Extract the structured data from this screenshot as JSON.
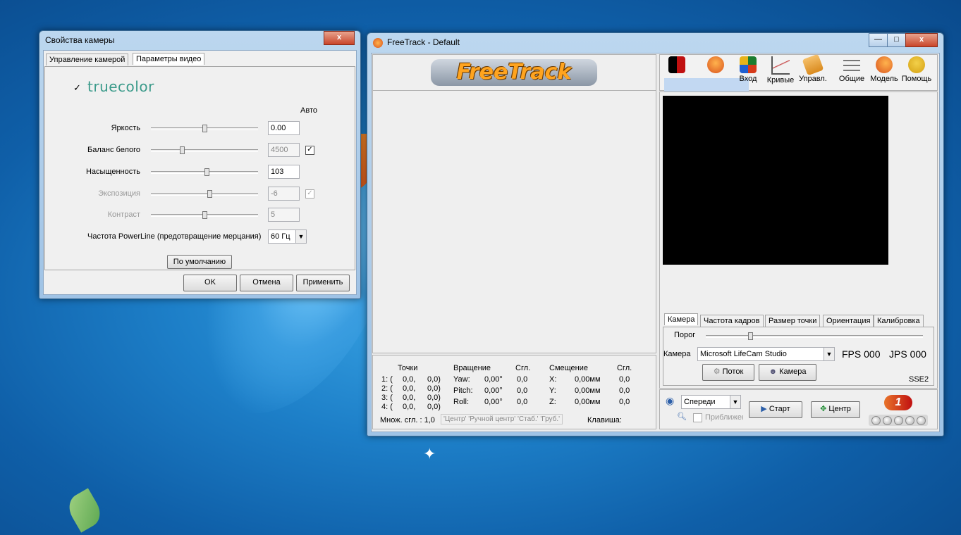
{
  "camera_dialog": {
    "title": "Свойства камеры",
    "close_glyph": "x",
    "tabs": [
      "Управление камерой",
      "Параметры видео"
    ],
    "logo_text": "truecolor",
    "logo_checked": "✓",
    "auto_header": "Авто",
    "rows": [
      {
        "label": "Яркость",
        "value": "0.00",
        "level": 0.5,
        "auto": null
      },
      {
        "label": "Баланс белого",
        "value": "4500",
        "level": 0.28,
        "auto": "✓"
      },
      {
        "label": "Насыщенность",
        "value": "103",
        "level": 0.52,
        "auto": null
      },
      {
        "label": "Экспозиция",
        "value": "-6",
        "level": 0.55,
        "auto": "✓"
      },
      {
        "label": "Контраст",
        "value": "5",
        "level": 0.5,
        "auto": null
      }
    ],
    "powerline_label": "Частота PowerLine (предотвращение мерцания)",
    "powerline_value": "60 Гц",
    "default_button": "По умолчанию",
    "ok_button": "OK",
    "cancel_button": "Отмена",
    "apply_button": "Применить"
  },
  "freetrack": {
    "title": "FreeTrack - Default",
    "logo_text": "FreeTrack",
    "min_glyph": "—",
    "max_glyph": "□",
    "close_glyph": "x",
    "toolbar": [
      {
        "label": "",
        "icon": "camera-icon"
      },
      {
        "label": "",
        "icon": "head-icon"
      },
      {
        "label": "Вход",
        "icon": "arrows-icon"
      },
      {
        "label": "Кривые",
        "icon": "curve-icon"
      },
      {
        "label": "Управл.",
        "icon": "keyboard-icon"
      },
      {
        "label": "Общие",
        "icon": "sliders-icon"
      },
      {
        "label": "Модель",
        "icon": "model-icon"
      },
      {
        "label": "Помощь",
        "icon": "help-icon"
      }
    ],
    "stats": {
      "points_header": "Точки",
      "rotation_header": "Вращение",
      "smooth_header1": "Сгл.",
      "offset_header": "Смещение",
      "smooth_header2": "Сгл.",
      "points": [
        {
          "id": "1: (",
          "x": "0,0,",
          "y": "0,0)"
        },
        {
          "id": "2: (",
          "x": "0,0,",
          "y": "0,0)"
        },
        {
          "id": "3: (",
          "x": "0,0,",
          "y": "0,0)"
        },
        {
          "id": "4: (",
          "x": "0,0,",
          "y": "0,0)"
        }
      ],
      "rotation": [
        {
          "axis": "Yaw:",
          "value": "0,00°",
          "smooth": "0,0"
        },
        {
          "axis": "Pitch:",
          "value": "0,00°",
          "smooth": "0,0"
        },
        {
          "axis": "Roll:",
          "value": "0,00°",
          "smooth": "0,0"
        }
      ],
      "offset": [
        {
          "axis": "X:",
          "value": "0,00мм",
          "smooth": "0,0"
        },
        {
          "axis": "Y:",
          "value": "0,00мм",
          "smooth": "0,0"
        },
        {
          "axis": "Z:",
          "value": "0,00мм",
          "smooth": "0,0"
        }
      ],
      "multiplier_label": "Множ. сгл. : 1,0",
      "hotkeys": "'Центр' 'Ручной центр' 'Стаб.' 'Груб.'",
      "key_label": "Клавиша:"
    },
    "tabs": [
      "Камера",
      "Частота кадров",
      "Размер точки",
      "Ориентация",
      "Калибровка"
    ],
    "threshold_label": "Порог",
    "threshold_level": 0.2,
    "camera_label": "Камера",
    "camera_value": "Microsoft LifeCam Studio",
    "fps_label": "FPS 000",
    "jps_label": "JPS 000",
    "stream_button": "Поток",
    "camera_button": "Камера",
    "sse_label": "SSE2",
    "view_value": "Спереди",
    "zoom_label": "Приближен",
    "start_button": "Старт",
    "center_button": "Центр",
    "badge_text": "1"
  }
}
